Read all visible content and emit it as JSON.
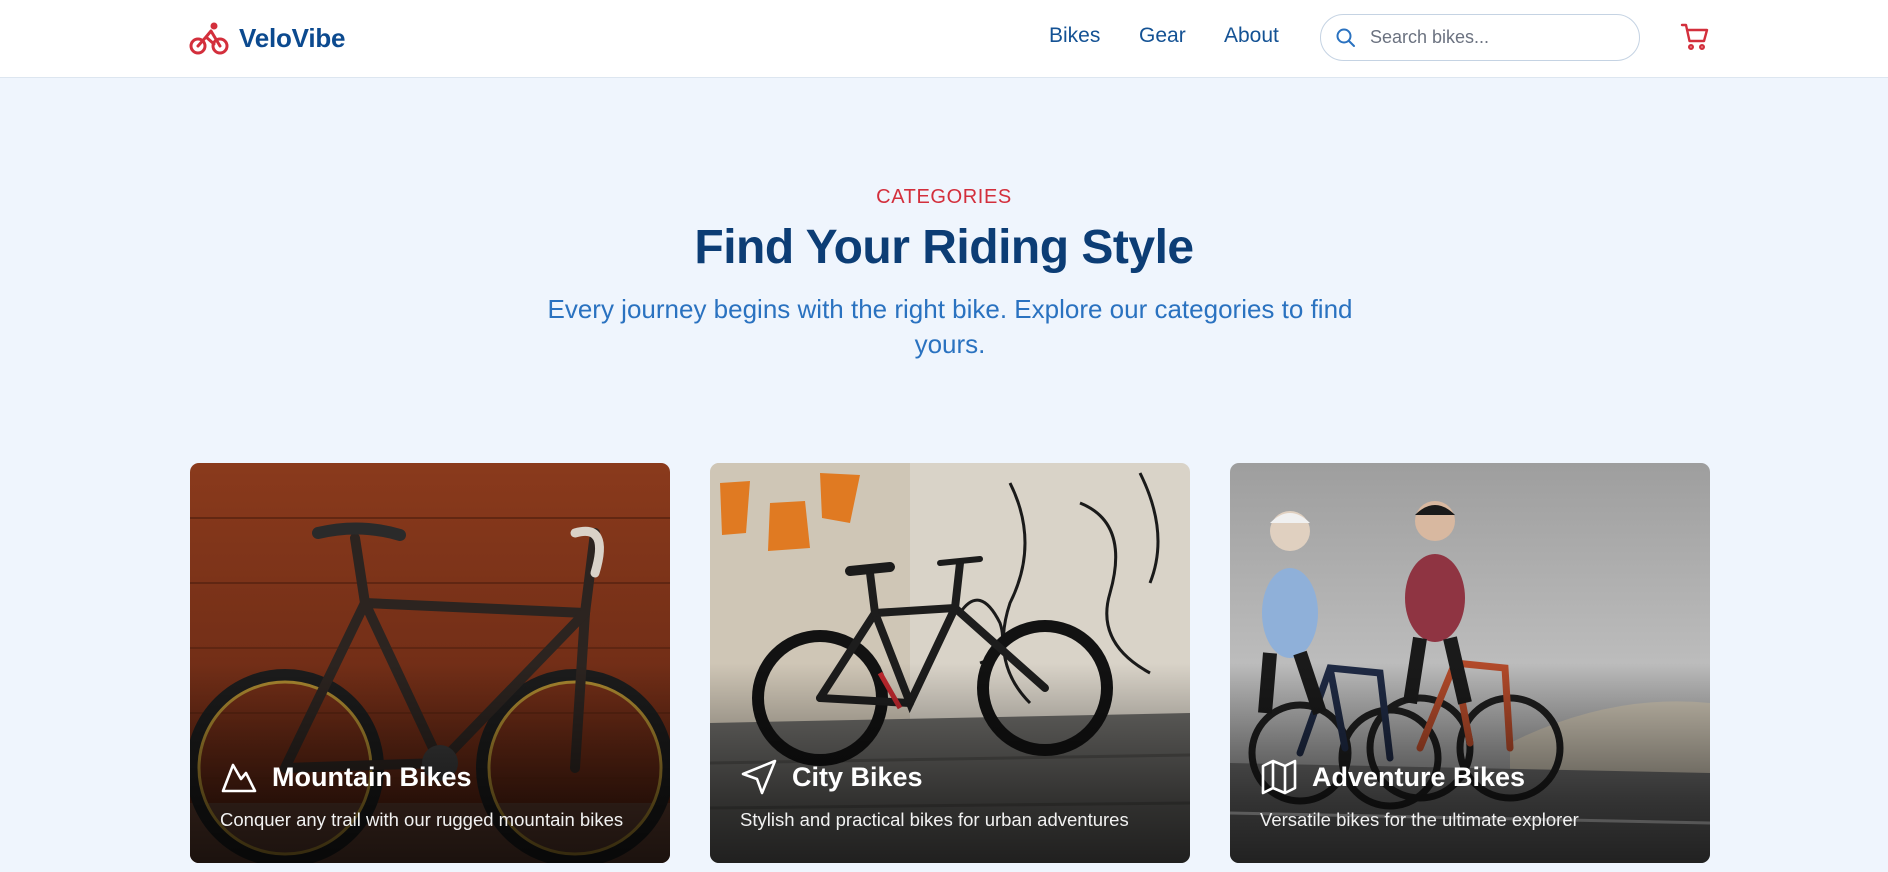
{
  "brand": {
    "name": "VeloVibe",
    "logo_icon": "bicycle-icon",
    "accent": "#d32f3c",
    "primary": "#0c3d75"
  },
  "nav": {
    "links": [
      "Bikes",
      "Gear",
      "About"
    ],
    "search_placeholder": "Search bikes...",
    "search_icon": "search-icon",
    "cart_icon": "shopping-cart-icon"
  },
  "hero": {
    "eyebrow": "CATEGORIES",
    "title": "Find Your Riding Style",
    "subtitle": "Every journey begins with the right bike. Explore our categories to find yours."
  },
  "categories": [
    {
      "title": "Mountain Bikes",
      "description": "Conquer any trail with our rugged mountain bikes",
      "icon": "mountain-icon"
    },
    {
      "title": "City Bikes",
      "description": "Stylish and practical bikes for urban adventures",
      "icon": "navigation-icon"
    },
    {
      "title": "Adventure Bikes",
      "description": "Versatile bikes for the ultimate explorer",
      "icon": "map-icon"
    }
  ]
}
